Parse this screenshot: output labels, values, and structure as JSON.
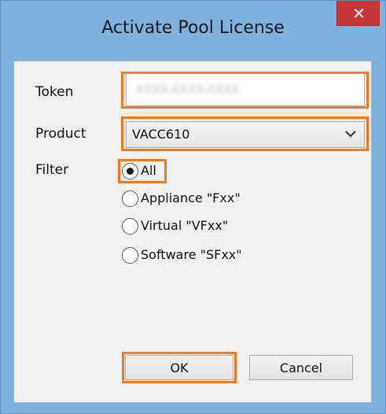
{
  "window": {
    "title": "Activate Pool License",
    "close_symbol": "✕"
  },
  "form": {
    "token_label": "Token",
    "token_value": "XXXX-XXXX-XXXX",
    "product_label": "Product",
    "product_value": "VACC610",
    "filter_label": "Filter",
    "filter_options": [
      {
        "label": "All",
        "selected": true
      },
      {
        "label": "Appliance \"Fxx\"",
        "selected": false
      },
      {
        "label": "Virtual \"VFxx\"",
        "selected": false
      },
      {
        "label": "Software \"SFxx\"",
        "selected": false
      }
    ]
  },
  "buttons": {
    "ok_label": "OK",
    "cancel_label": "Cancel"
  },
  "icons": {
    "close": "close-icon",
    "dropdown": "chevron-down-icon",
    "radio_selected": "radio-selected-icon",
    "radio_empty": "radio-empty-icon"
  },
  "colors": {
    "highlight": "#f07a22",
    "close_button": "#c7373a",
    "window_frame": "#7eb1dd",
    "client_background": "#f0f0f0"
  }
}
